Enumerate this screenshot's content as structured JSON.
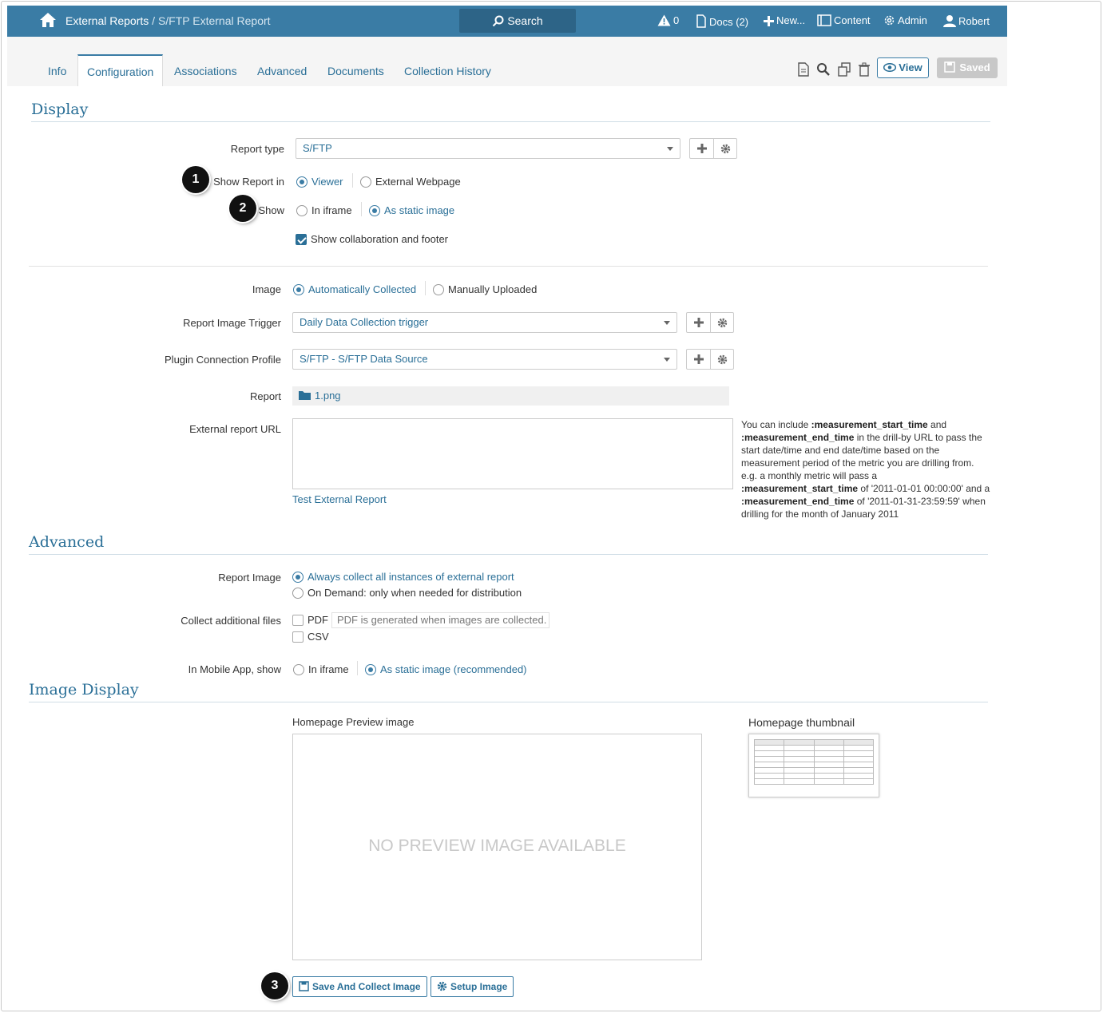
{
  "topbar": {
    "breadcrumb_main": "External Reports",
    "breadcrumb_sep": " / ",
    "breadcrumb_sub": "S/FTP External Report",
    "search_label": "Search",
    "alerts_count": "0",
    "docs_label": "Docs (2)",
    "new_label": "New...",
    "content_label": "Content",
    "admin_label": "Admin",
    "user_label": "Robert"
  },
  "tabs": [
    "Info",
    "Configuration",
    "Associations",
    "Advanced",
    "Documents",
    "Collection History"
  ],
  "toolbar": {
    "view_label": "View",
    "saved_label": "Saved"
  },
  "display": {
    "title": "Display",
    "report_type_label": "Report type",
    "report_type_value": "S/FTP",
    "show_report_in_label": "Show Report in",
    "show_report_in_options": [
      "Viewer",
      "External Webpage"
    ],
    "show_label": "Show",
    "show_options": [
      "In iframe",
      "As static image"
    ],
    "collab_footer_label": "Show collaboration and footer",
    "image_label": "Image",
    "image_options": [
      "Automatically Collected",
      "Manually Uploaded"
    ],
    "trigger_label": "Report Image Trigger",
    "trigger_value": "Daily Data Collection trigger",
    "profile_label": "Plugin Connection Profile",
    "profile_value": "S/FTP - S/FTP Data Source",
    "report_label": "Report",
    "report_file": "1.png",
    "url_label": "External report URL",
    "test_link": "Test External Report",
    "help": {
      "p1": "You can include ",
      "k1": ":measurement_start_time",
      "p2": " and ",
      "k2": ":measurement_end_time",
      "p3": " in the drill-by URL to pass the start date/time and end date/time based on the measurement period of the metric you are drilling from. e.g. a monthly metric will pass a ",
      "k3": ":measurement_start_time",
      "p4": " of '2011-01-01 00:00:00' and a ",
      "k4": ":measurement_end_time",
      "p5": " of '2011-01-31-23:59:59' when drilling for the month of January 2011"
    }
  },
  "advanced": {
    "title": "Advanced",
    "report_image_label": "Report Image",
    "report_image_options": [
      "Always collect all instances of external report",
      "On Demand: only when needed for distribution"
    ],
    "additional_files_label": "Collect additional files",
    "pdf_label": "PDF",
    "pdf_note": "PDF is generated when images are collected.",
    "csv_label": "CSV",
    "mobile_label": "In Mobile App, show",
    "mobile_options": [
      "In iframe",
      "As static image (recommended)"
    ]
  },
  "image_display": {
    "title": "Image Display",
    "preview_label": "Homepage Preview image",
    "no_preview": "NO PREVIEW IMAGE AVAILABLE",
    "thumbnail_label": "Homepage thumbnail",
    "save_collect_label": "Save And Collect Image",
    "setup_label": "Setup Image"
  },
  "callouts": [
    "1",
    "2",
    "3"
  ],
  "colors": {
    "accent": "#3a7ca5",
    "link": "#2a6f97",
    "topbar": "#3a7ca5"
  }
}
